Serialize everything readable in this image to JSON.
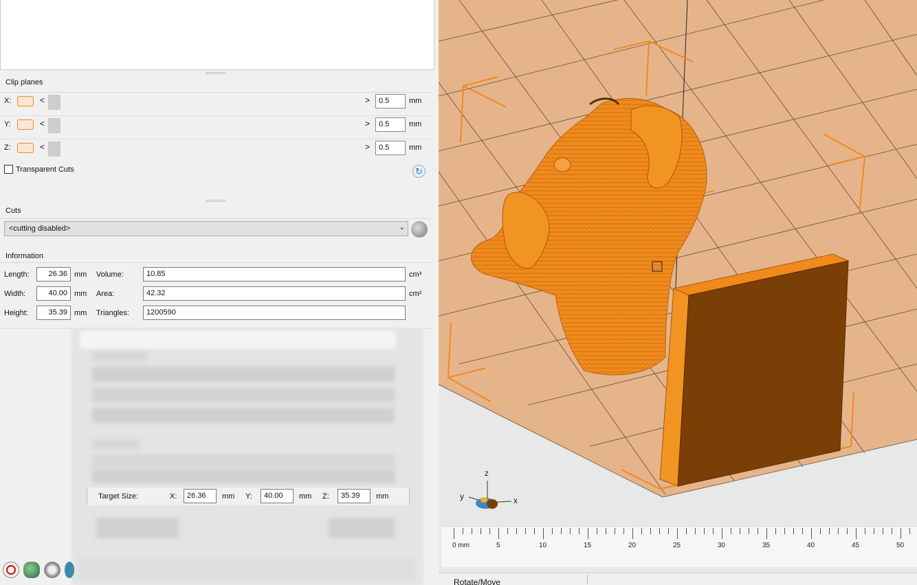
{
  "clip_planes": {
    "title": "Clip planes",
    "rows": [
      {
        "axis": "X:",
        "value": "0.5",
        "unit": "mm"
      },
      {
        "axis": "Y:",
        "value": "0.5",
        "unit": "mm"
      },
      {
        "axis": "Z:",
        "value": "0.5",
        "unit": "mm"
      }
    ],
    "arrow_left": "<",
    "arrow_right": ">",
    "transparent_cuts": "Transparent Cuts",
    "transparent_cuts_checked": false
  },
  "cuts": {
    "title": "Cuts",
    "selected": "<cutting disabled>"
  },
  "information": {
    "title": "Information",
    "length_label": "Length:",
    "length": "26.36",
    "length_unit": "mm",
    "width_label": "Width:",
    "width": "40.00",
    "width_unit": "mm",
    "height_label": "Height:",
    "height": "35.39",
    "height_unit": "mm",
    "volume_label": "Volume:",
    "volume": "10.85",
    "volume_unit": "cm³",
    "area_label": "Area:",
    "area": "42.32",
    "area_unit": "cm²",
    "triangles_label": "Triangles:",
    "triangles": "1200590"
  },
  "target_size": {
    "label": "Target Size:",
    "x_label": "X:",
    "x": "26.36",
    "y_label": "Y:",
    "y": "40.00",
    "z_label": "Z:",
    "z": "35.39",
    "unit": "mm"
  },
  "viewport": {
    "axes": {
      "x": "x",
      "y": "y",
      "z": "z"
    },
    "ruler_labels": [
      "0 mm",
      "5",
      "10",
      "15",
      "20",
      "25",
      "30",
      "35",
      "40",
      "45",
      "50"
    ],
    "status": "Rotate/Move",
    "model_color": "#f08a1c",
    "plate_color": "#e6b48a"
  }
}
